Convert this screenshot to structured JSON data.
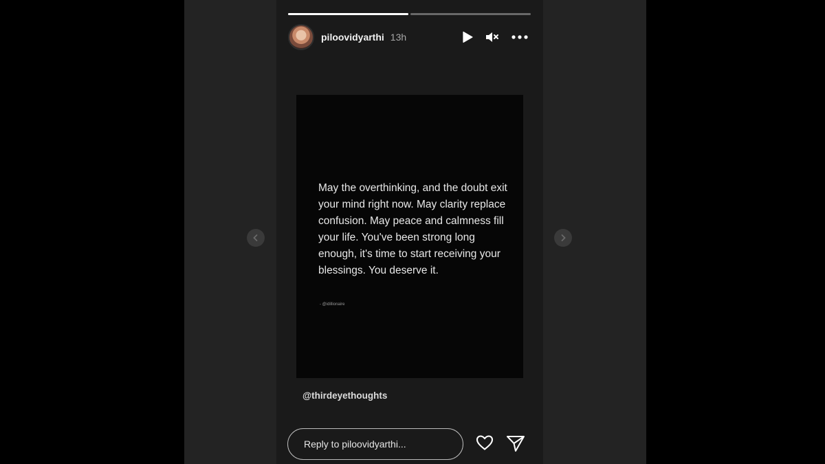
{
  "story": {
    "progress": [
      1,
      0
    ],
    "username": "piloovidyarthi",
    "time": "13h",
    "post": {
      "quote": "May the overthinking, and the doubt exit your mind right now. May clarity replace confusion. May peace and calmness fill your life. You've been strong long enough, it's time to start receiving your blessings. You deserve it.",
      "credit": "- @idillionaire"
    },
    "mention": "@thirdeyethoughts",
    "reply_placeholder": "Reply to piloovidyarthi..."
  },
  "icons": {
    "play": "play-icon",
    "mute": "muted-speaker-icon",
    "more": "more-options-icon",
    "like": "heart-icon",
    "share": "send-icon",
    "prev": "chevron-left-icon",
    "next": "chevron-right-icon"
  },
  "colors": {
    "background": "#000000",
    "panel": "#232323",
    "story": "#1a1a1a"
  }
}
